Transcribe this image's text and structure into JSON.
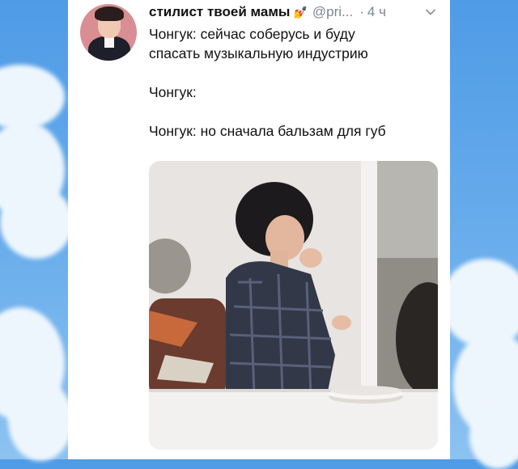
{
  "background": {
    "sky_color": "#5fa5ea",
    "cloud_color": "#eef6fd"
  },
  "tweet": {
    "display_name": "стилист твоей мамы",
    "name_emoji": "💅",
    "handle": "@pri...",
    "separator": "·",
    "time": "4 ч",
    "chevron": "chevron-down-icon",
    "lines": [
      "Чонгук: сейчас соберусь и буду",
      "спасать музыкальную индустрию",
      "",
      "Чонгук:",
      "",
      "Чонгук: но сначала бальзам для губ"
    ]
  },
  "media": {
    "type": "photo"
  }
}
